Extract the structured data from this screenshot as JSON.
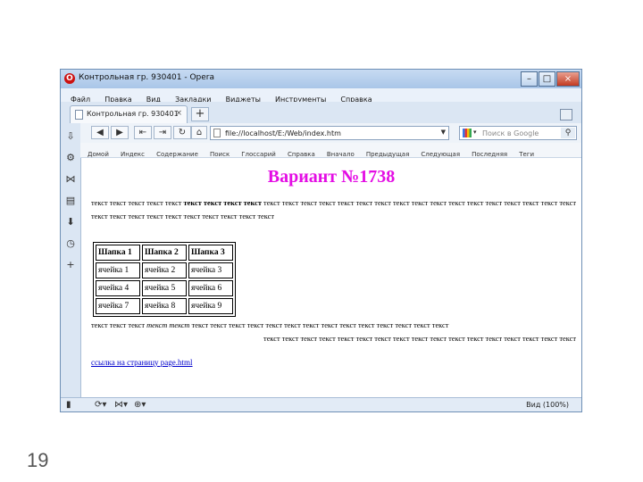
{
  "slide_number": "19",
  "window": {
    "title": "Контрольная гр. 930401 - Opera",
    "controls": [
      "–",
      "□",
      "×"
    ]
  },
  "menu": [
    "Файл",
    "Правка",
    "Вид",
    "Закладки",
    "Виджеты",
    "Инструменты",
    "Справка"
  ],
  "tab": {
    "label": "Контрольная гр. 930401",
    "close": "×",
    "new": "+"
  },
  "nav": {
    "url": "file://localhost/E:/Web/index.htm",
    "search_placeholder": "Поиск в Google"
  },
  "bookmarks": [
    "Домой",
    "Индекс",
    "Содержание",
    "Поиск",
    "Глоссарий",
    "Справка",
    "Вначало",
    "Предыдущая",
    "Следующая",
    "Последняя",
    "Теги"
  ],
  "page": {
    "heading": "Вариант №1738",
    "para1": {
      "a": "текст текст текст текст текст ",
      "bold": "текст текст текст текст",
      "b": " текст текст текст текст текст текст текст текст текст текст текст текст текст текст текст текст текст текст текст текст текст текст текст текст текст текст текст"
    },
    "table": {
      "headers": [
        "Шапка 1",
        "Шапка 2",
        "Шапка 3"
      ],
      "rows": [
        [
          "ячейка 1",
          "ячейка 2",
          "ячейка 3"
        ],
        [
          "ячейка 4",
          "ячейка 5",
          "ячейка 6"
        ],
        [
          "ячейка 7",
          "ячейка 8",
          "ячейка 9"
        ]
      ]
    },
    "para2": {
      "a": "текст текст текст ",
      "italic": "текст текст",
      "b": " текст текст текст текст текст текст текст текст текст текст текст текст текст текст",
      "line2": "текст текст текст текст текст текст текст текст текст текст текст текст текст текст текст текст текст"
    },
    "link": "ссылка на страницу page.html"
  },
  "status": {
    "zoom": "Вид (100%)"
  }
}
